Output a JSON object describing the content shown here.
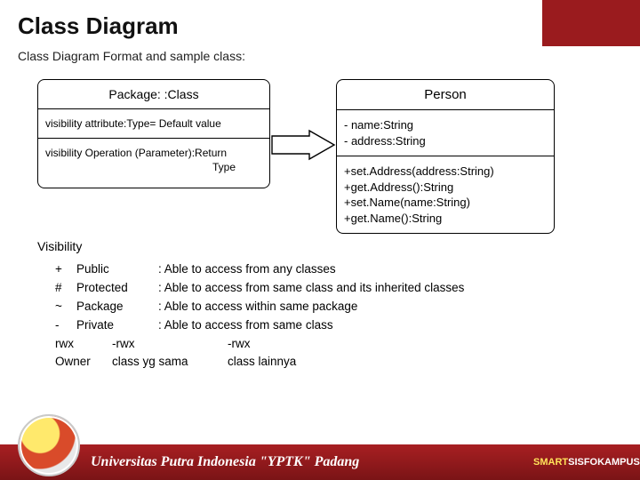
{
  "title": "Class Diagram",
  "subtitle": "Class Diagram Format and sample class:",
  "format_box": {
    "header": "Package: :Class",
    "attr_line": "visibility attribute:Type= Default value",
    "op_line1": "visibility Operation (Parameter):Return",
    "op_line2": "Type"
  },
  "sample_box": {
    "header": "Person",
    "attrs": [
      "- name:String",
      "- address:String"
    ],
    "ops": [
      "+set.Address(address:String)",
      "+get.Address():String",
      "+set.Name(name:String)",
      "+get.Name():String"
    ]
  },
  "visibility": {
    "label": "Visibility",
    "rows": [
      {
        "sym": "+",
        "name": "Public",
        "desc": ": Able to access from any classes"
      },
      {
        "sym": "#",
        "name": "Protected",
        "desc": ": Able to access from same class and its inherited classes"
      },
      {
        "sym": "~",
        "name": "Package",
        "desc": ": Able to access within same package"
      },
      {
        "sym": "-",
        "name": " Private",
        "desc": ": Able to access from same class"
      }
    ],
    "perm1": {
      "c1": "rwx",
      "c2": "-rwx",
      "c3": "-rwx"
    },
    "perm2": {
      "c1": "Owner",
      "c2": "class yg sama",
      "c3": "class lainnya"
    }
  },
  "footer": {
    "uni": "Universitas Putra Indonesia \"YPTK\" Padang",
    "brand_smart": "SMART",
    "brand_rest": "SISFOKAMPUS"
  }
}
